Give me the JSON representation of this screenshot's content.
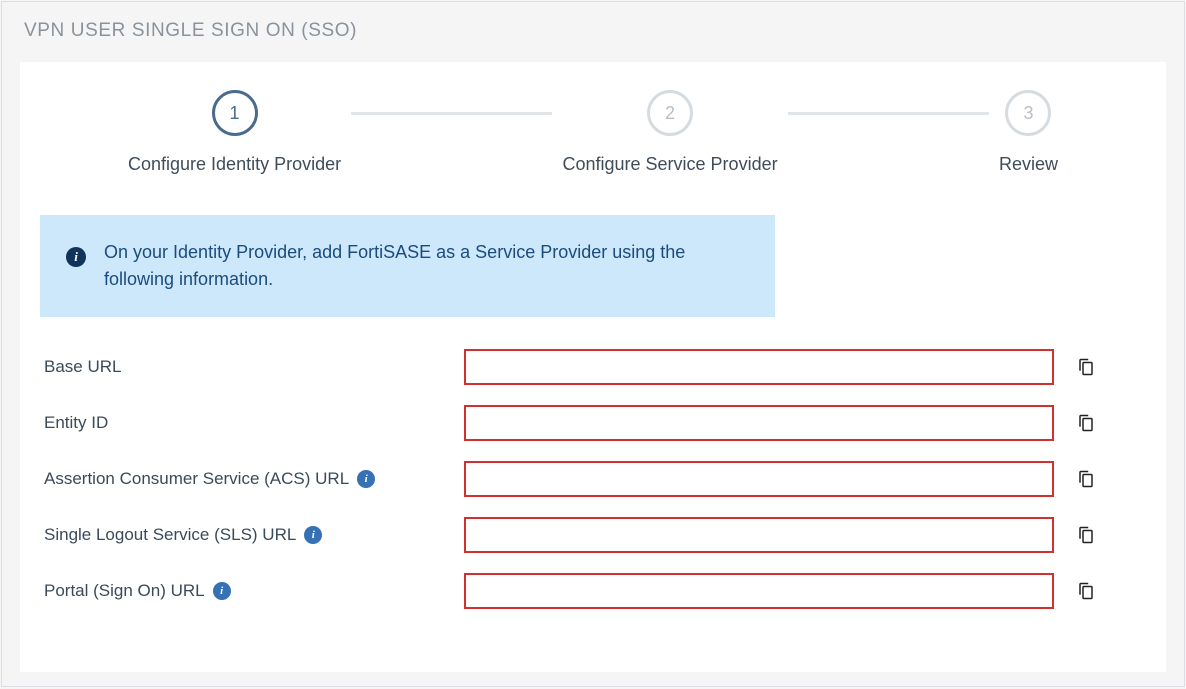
{
  "panel": {
    "title": "VPN USER SINGLE SIGN ON (SSO)"
  },
  "stepper": {
    "steps": [
      {
        "num": "1",
        "label": "Configure Identity Provider",
        "active": true
      },
      {
        "num": "2",
        "label": "Configure Service Provider",
        "active": false
      },
      {
        "num": "3",
        "label": "Review",
        "active": false
      }
    ]
  },
  "alert": {
    "text": "On your Identity Provider, add FortiSASE as a Service Provider using the following information."
  },
  "fields": [
    {
      "label": "Base URL",
      "info": false,
      "value": ""
    },
    {
      "label": "Entity ID",
      "info": false,
      "value": ""
    },
    {
      "label": "Assertion Consumer Service (ACS) URL",
      "info": true,
      "value": ""
    },
    {
      "label": "Single Logout Service (SLS) URL",
      "info": true,
      "value": ""
    },
    {
      "label": "Portal (Sign On) URL",
      "info": true,
      "value": ""
    }
  ]
}
